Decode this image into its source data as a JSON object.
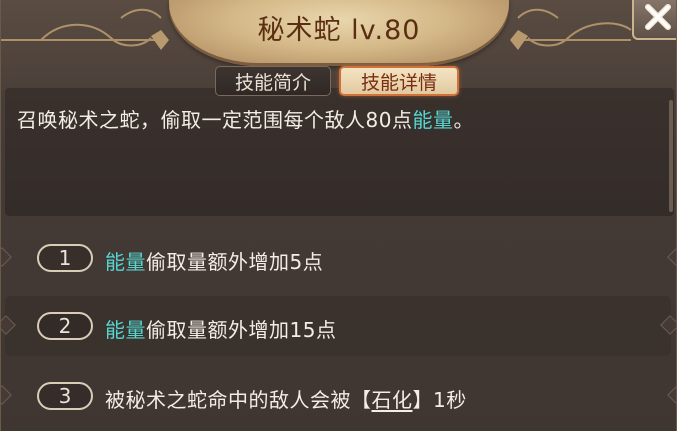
{
  "window": {
    "title": "秘术蛇 lv.80"
  },
  "tabs": [
    {
      "label": "技能简介",
      "active": false
    },
    {
      "label": "技能详情",
      "active": true
    }
  ],
  "description": {
    "prefix": "召唤秘术之蛇，偷取一定范围每个敌人80点",
    "highlight": "能量",
    "suffix": "。"
  },
  "upgrades": [
    {
      "number": "1",
      "highlight": "能量",
      "text": "偷取量额外增加5点"
    },
    {
      "number": "2",
      "highlight": "能量",
      "text": "偷取量额外增加15点"
    },
    {
      "number": "3",
      "text_before": "被秘术之蛇命中的敌人会被",
      "bracket_open": "【",
      "status": "石化",
      "bracket_close": "】",
      "text_after": "1秒"
    }
  ],
  "colors": {
    "highlight": "#55d6d3",
    "title": "#5a2e12",
    "active_tab_border": "#d0713a"
  },
  "icons": {
    "close": "close-icon"
  }
}
